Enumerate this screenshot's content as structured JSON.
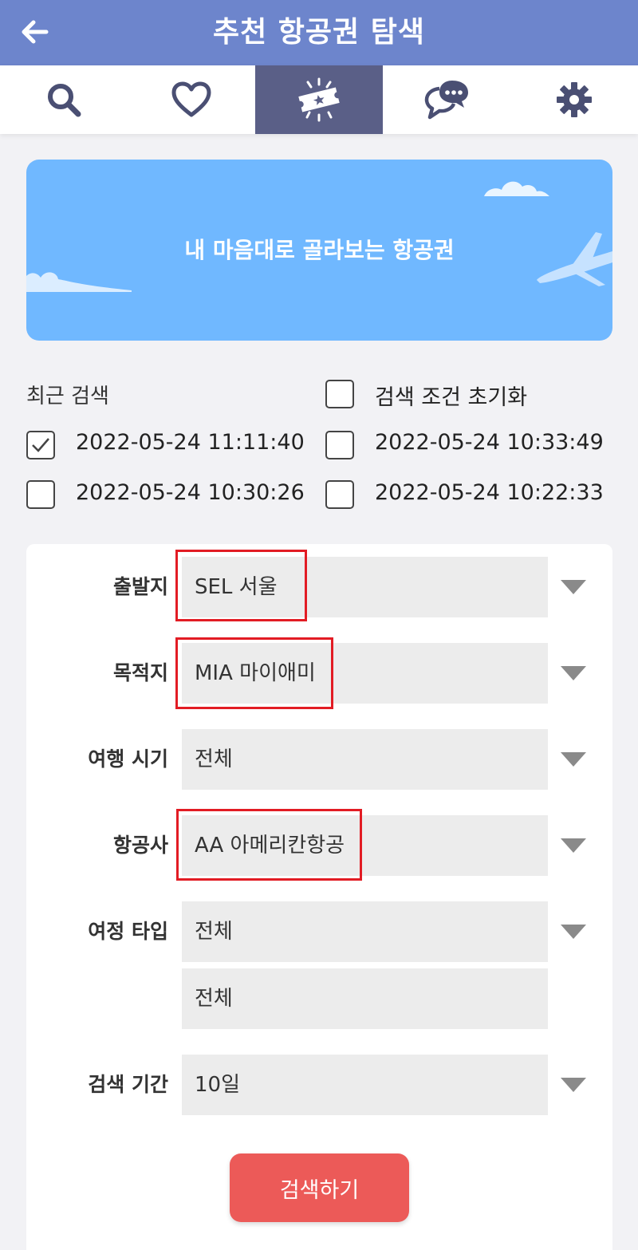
{
  "header": {
    "title": "추천 항공권 탐색"
  },
  "tabs": [
    {
      "icon": "search-icon"
    },
    {
      "icon": "heart-icon"
    },
    {
      "icon": "ticket-icon",
      "active": true
    },
    {
      "icon": "chat-icon"
    },
    {
      "icon": "gear-icon"
    }
  ],
  "banner": {
    "text": "내 마음대로 골라보는 항공권"
  },
  "recent": {
    "label": "최근 검색",
    "reset_label": "검색 조건 초기화",
    "items": [
      {
        "text": "2022-05-24 11:11:40",
        "checked": true
      },
      {
        "text": "2022-05-24 10:33:49",
        "checked": false
      },
      {
        "text": "2022-05-24 10:30:26",
        "checked": false
      },
      {
        "text": "2022-05-24 10:22:33",
        "checked": false
      }
    ]
  },
  "form": {
    "departure": {
      "label": "출발지",
      "value": "SEL 서울"
    },
    "destination": {
      "label": "목적지",
      "value": "MIA 마이애미"
    },
    "period": {
      "label": "여행 시기",
      "value": "전체"
    },
    "airline": {
      "label": "항공사",
      "value": "AA 아메리칸항공"
    },
    "trip_type": {
      "label": "여정 타입",
      "value": "전체",
      "value2": "전체"
    },
    "duration": {
      "label": "검색 기간",
      "value": "10일"
    },
    "search_button": "검색하기"
  },
  "colors": {
    "header": "#6d85cc",
    "active_tab": "#5a5f87",
    "banner": "#70b8ff",
    "button": "#ec5a58",
    "highlight": "#e21c24"
  }
}
